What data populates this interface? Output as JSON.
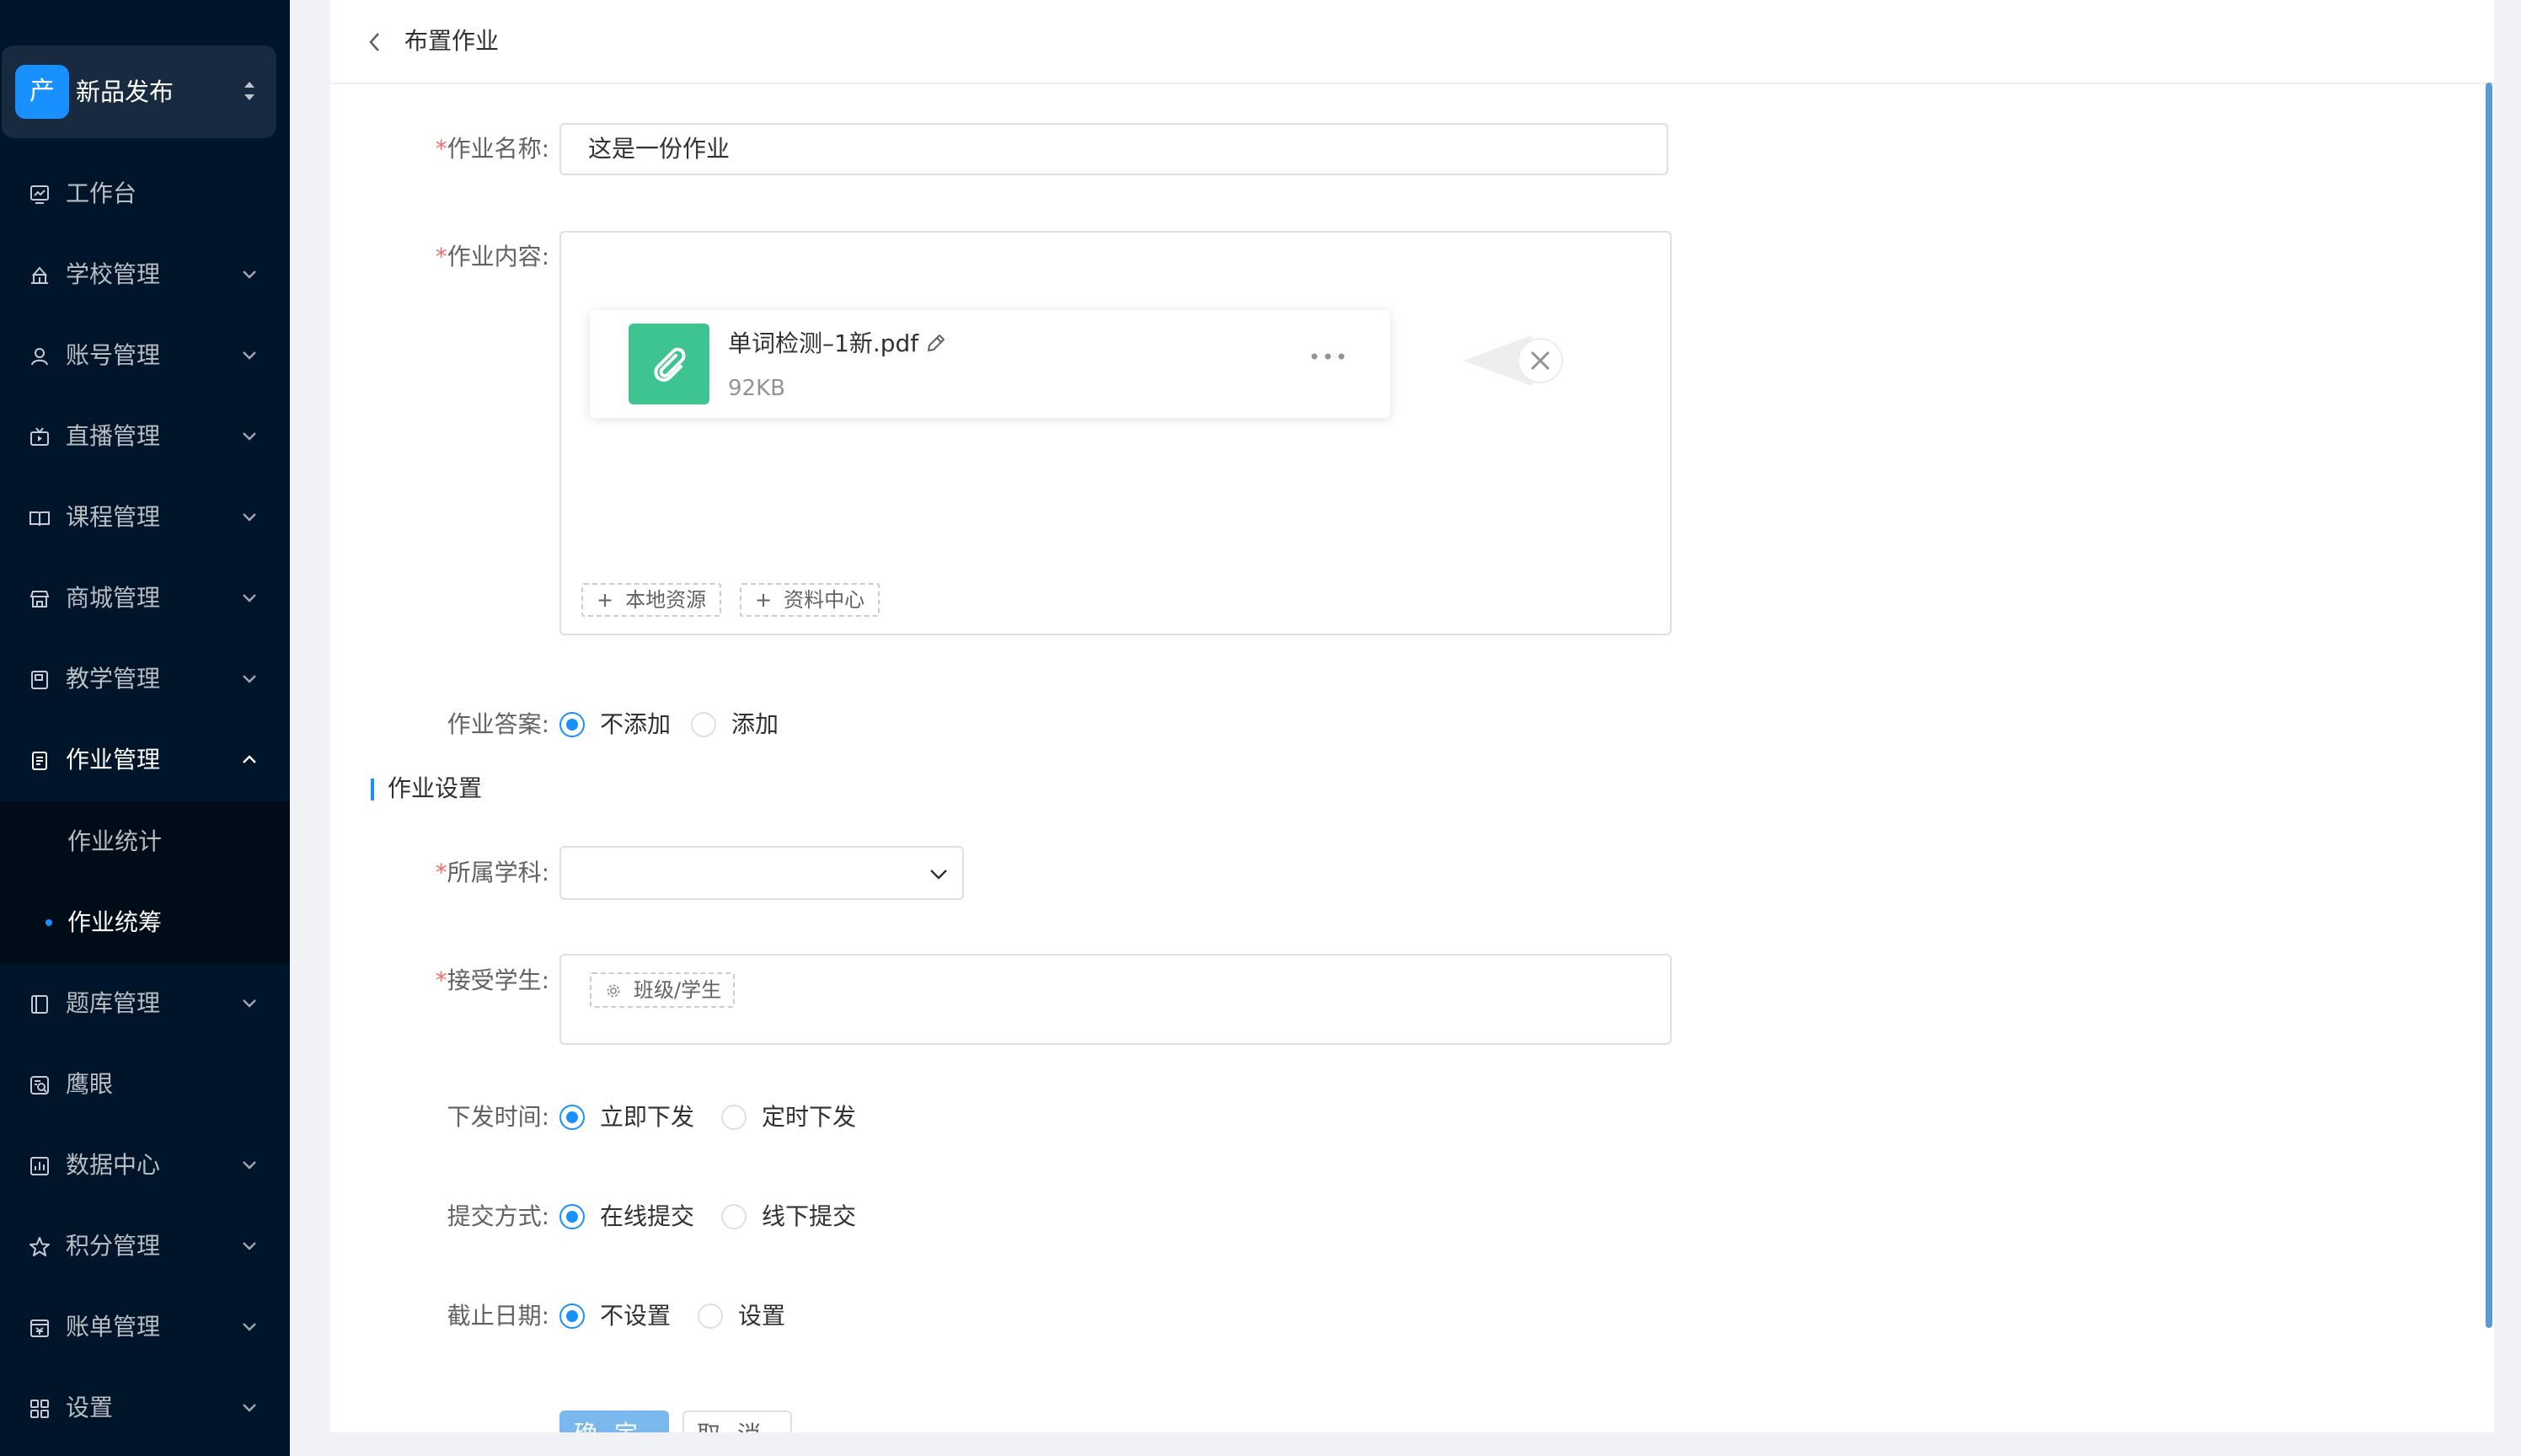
{
  "brand": {
    "logo_char": "产",
    "name": "新品发布"
  },
  "sidebar": {
    "items": [
      {
        "label": "工作台"
      },
      {
        "label": "学校管理"
      },
      {
        "label": "账号管理"
      },
      {
        "label": "直播管理"
      },
      {
        "label": "课程管理"
      },
      {
        "label": "商城管理"
      },
      {
        "label": "教学管理"
      },
      {
        "label": "作业管理"
      },
      {
        "label": "题库管理"
      },
      {
        "label": "鹰眼"
      },
      {
        "label": "数据中心"
      },
      {
        "label": "积分管理"
      },
      {
        "label": "账单管理"
      },
      {
        "label": "设置"
      }
    ],
    "submenu": [
      {
        "label": "作业统计"
      },
      {
        "label": "作业统筹"
      }
    ]
  },
  "header": {
    "title": "布置作业"
  },
  "form": {
    "required_mark": "*",
    "name": {
      "label": "作业名称:",
      "value": "这是一份作业"
    },
    "content": {
      "label": "作业内容:",
      "file": {
        "name": "单词检测–1新.pdf",
        "size": "92KB"
      },
      "local_button": "本地资源",
      "library_button": "资料中心",
      "plus": "+"
    },
    "answer": {
      "label": "作业答案:",
      "options": [
        "不添加",
        "添加"
      ],
      "selected": "不添加"
    },
    "section_title": "作业设置",
    "subject": {
      "label": "所属学科:",
      "value": ""
    },
    "students": {
      "label": "接受学生:",
      "button": "班级/学生"
    },
    "publish_time": {
      "label": "下发时间:",
      "options": [
        "立即下发",
        "定时下发"
      ],
      "selected": "立即下发"
    },
    "submit_method": {
      "label": "提交方式:",
      "options": [
        "在线提交",
        "线下提交"
      ],
      "selected": "在线提交"
    },
    "deadline": {
      "label": "截止日期:",
      "options": [
        "不设置",
        "设置"
      ],
      "selected": "不设置"
    },
    "confirm_button": "确定",
    "cancel_button": "取消"
  }
}
